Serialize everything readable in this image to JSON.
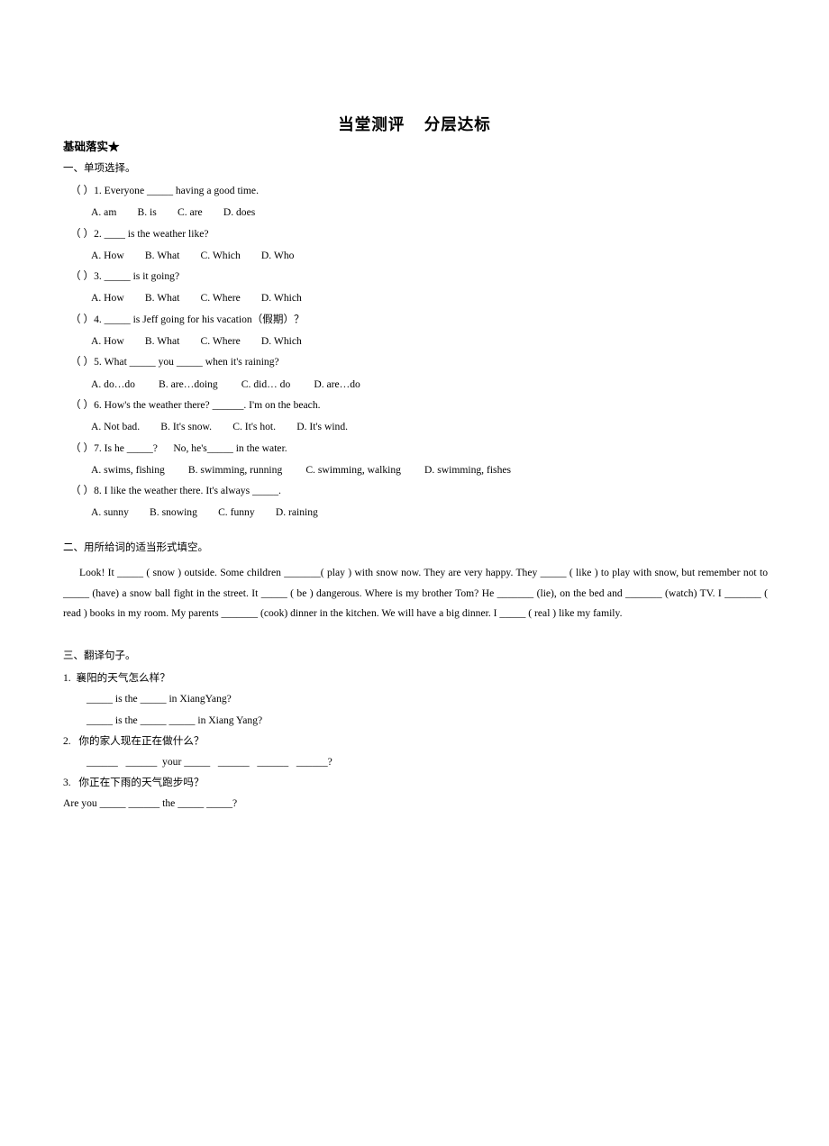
{
  "document": {
    "title": "当堂测评    分层达标",
    "section_heading": "基础落实★"
  },
  "part_one": {
    "heading": "一、单项选择。",
    "questions": [
      {
        "stem": "（ ）1. Everyone _____ having a good time.",
        "options": "A. am        B. is        C. are        D. does"
      },
      {
        "stem": "（ ）2. ____ is the weather like?",
        "options": "A. How        B. What        C. Which        D. Who"
      },
      {
        "stem": "（ ）3. _____ is it going?",
        "options": "A. How        B. What        C. Where        D. Which"
      },
      {
        "stem": "（ ）4. _____ is Jeff going for his vacation（假期）？",
        "options": "A. How        B. What        C. Where        D. Which"
      },
      {
        "stem": "（ ）5. What _____ you _____ when it's raining?",
        "options": "A. do…do         B. are…doing         C. did… do         D. are…do"
      },
      {
        "stem": "（ ）6. How's the weather there? ______. I'm on the beach.",
        "options": "A. Not bad.        B. It's snow.        C. It's hot.        D. It's wind."
      },
      {
        "stem": "（ ）7. Is he _____?      No, he's_____ in the water.",
        "options": "A. swims, fishing         B. swimming, running         C. swimming, walking         D. swimming, fishes"
      },
      {
        "stem": "（ ）8. I like the weather there. It's always _____.",
        "options": "A. sunny        B. snowing        C. funny        D. raining"
      }
    ]
  },
  "part_two": {
    "heading": "二、用所给词的适当形式填空。",
    "paragraph": "Look! It _____ ( snow ) outside. Some children _______( play ) with snow now. They are very happy. They _____ ( like ) to play with snow, but remember not to _____ (have) a snow ball fight in the street. It _____ ( be ) dangerous. Where is my brother Tom? He _______ (lie), on the bed and _______ (watch) TV. I _______ ( read ) books in my room. My parents _______ (cook) dinner in the kitchen. We will have a big dinner. I _____ ( real ) like my family."
  },
  "part_three": {
    "heading": "三、翻译句子。",
    "items": [
      {
        "chinese": "1.  襄阳的天气怎么样？",
        "answers": [
          "_____ is the _____ in XiangYang?",
          "_____ is the _____ _____ in Xiang Yang?"
        ],
        "flush": false
      },
      {
        "chinese": "2.   你的家人现在正在做什么？",
        "answers": [
          "______   ______  your _____   ______   ______   ______?"
        ],
        "flush": false
      },
      {
        "chinese": "3.   你正在下雨的天气跑步吗？",
        "answers": [
          "Are you _____ ______ the _____ _____?"
        ],
        "flush": true
      }
    ]
  }
}
